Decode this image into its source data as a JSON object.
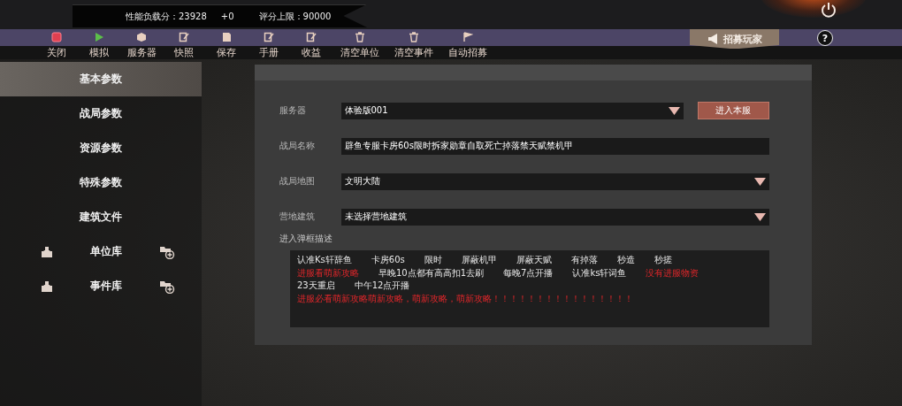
{
  "header": {
    "load_label": "性能负载分：23928",
    "delta": "+0",
    "limit_label": "评分上限：90000"
  },
  "toolbar": [
    "关闭",
    "模拟",
    "服务器",
    "快照",
    "保存",
    "手册",
    "收益",
    "清空单位",
    "清空事件",
    "自动招募"
  ],
  "recruit_button": "招募玩家",
  "help_button": "?",
  "sidebar": [
    {
      "label": "基本参数",
      "selected": true,
      "kind": "tab"
    },
    {
      "label": "战局参数",
      "selected": false,
      "kind": "tab"
    },
    {
      "label": "资源参数",
      "selected": false,
      "kind": "tab"
    },
    {
      "label": "特殊参数",
      "selected": false,
      "kind": "tab"
    },
    {
      "label": "建筑文件",
      "selected": false,
      "kind": "tab"
    },
    {
      "label": "单位库",
      "selected": false,
      "kind": "library"
    },
    {
      "label": "事件库",
      "selected": false,
      "kind": "library"
    }
  ],
  "form": {
    "server": {
      "label": "服务器",
      "value": "体验版001",
      "button": "进入本服"
    },
    "name": {
      "label": "战局名称",
      "value": "辟鱼专服卡房60s限时拆家勋章自取死亡掉落禁天赋禁机甲"
    },
    "map": {
      "label": "战局地图",
      "value": "文明大陆"
    },
    "building": {
      "label": "营地建筑",
      "value": "未选择营地建筑"
    },
    "description": {
      "label": "进入弹框描述",
      "lines": [
        [
          {
            "text": "认准Ks轩辞鱼",
            "highlighted": false
          },
          {
            "text": "卡房60s",
            "highlighted": false
          },
          {
            "text": "限时",
            "highlighted": false
          },
          {
            "text": "屏蔽机甲",
            "highlighted": false
          },
          {
            "text": "屏蔽天赋",
            "highlighted": false
          },
          {
            "text": "有掉落",
            "highlighted": false
          },
          {
            "text": "秒造",
            "highlighted": false
          },
          {
            "text": "秒搓",
            "highlighted": false
          }
        ],
        [
          {
            "text": "进服看萌新攻略",
            "highlighted": true
          },
          {
            "text": "早晚10点都有高高扣1去刷",
            "highlighted": false
          },
          {
            "text": "每晚7点开播",
            "highlighted": false
          },
          {
            "text": "认准ks轩词鱼",
            "highlighted": false
          },
          {
            "text": "没有进服物资",
            "highlighted": true
          }
        ],
        [
          {
            "text": "23天重启",
            "highlighted": false
          },
          {
            "text": "中午12点开播",
            "highlighted": false
          }
        ],
        [
          {
            "text": "进服必看萌新攻略萌新攻略，萌新攻略，萌新攻略！！！！！！！！！！！！！！！！",
            "highlighted": true
          }
        ]
      ]
    }
  }
}
